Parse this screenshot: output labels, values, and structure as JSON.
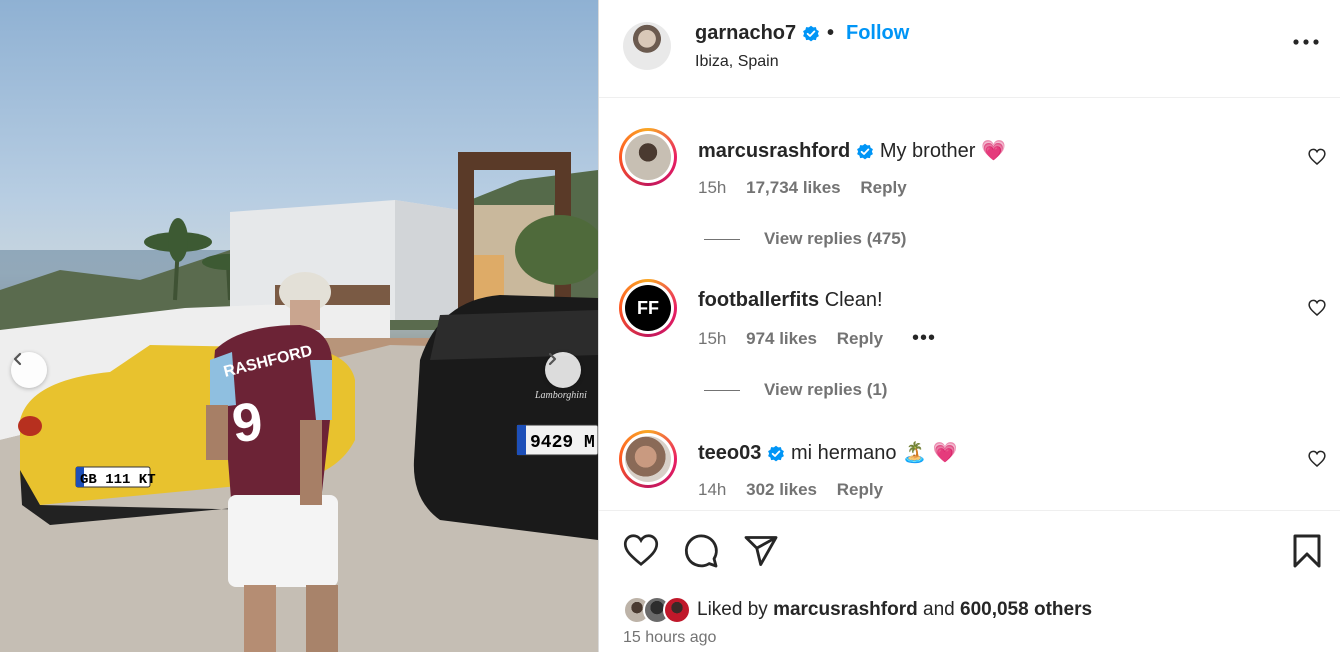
{
  "post": {
    "username": "garnacho7",
    "separator": "•",
    "follow_label": "Follow",
    "location": "Ibiza, Spain",
    "photo_text": {
      "jersey_name": "RASHFORD",
      "jersey_number": "9",
      "plate_left": "GB 111 KT",
      "plate_right": "9429 M",
      "car_brand": "Lamborghini"
    }
  },
  "comments": [
    {
      "username": "marcusrashford",
      "text": "My brother",
      "emoji": "💗",
      "time": "15h",
      "likes": "17,734 likes",
      "reply_label": "Reply",
      "view_replies": "View replies (475)",
      "verified": true
    },
    {
      "username": "footballerfits",
      "text": "Clean!",
      "emoji": "",
      "time": "15h",
      "likes": "974 likes",
      "reply_label": "Reply",
      "more": "•••",
      "view_replies": "View replies (1)",
      "verified": false,
      "avatar_text": "FF"
    },
    {
      "username": "teeo03",
      "text": "mi hermano",
      "emoji": "🏝️ 💗",
      "time": "14h",
      "likes": "302 likes",
      "reply_label": "Reply",
      "verified": true
    }
  ],
  "footer": {
    "liked_prefix": "Liked by",
    "liked_user": "marcusrashford",
    "liked_and": "and",
    "liked_count": "600,058 others",
    "timestamp": "15 hours ago"
  },
  "icons": {
    "verified": "verified-badge-icon",
    "heart": "heart-icon",
    "comment": "comment-icon",
    "share": "share-icon",
    "save": "bookmark-icon",
    "more": "more-options-icon",
    "prev": "chevron-left-icon",
    "next": "chevron-right-icon"
  },
  "colors": {
    "link": "#0095f6",
    "verified": "#0095f6",
    "muted": "#737373"
  }
}
